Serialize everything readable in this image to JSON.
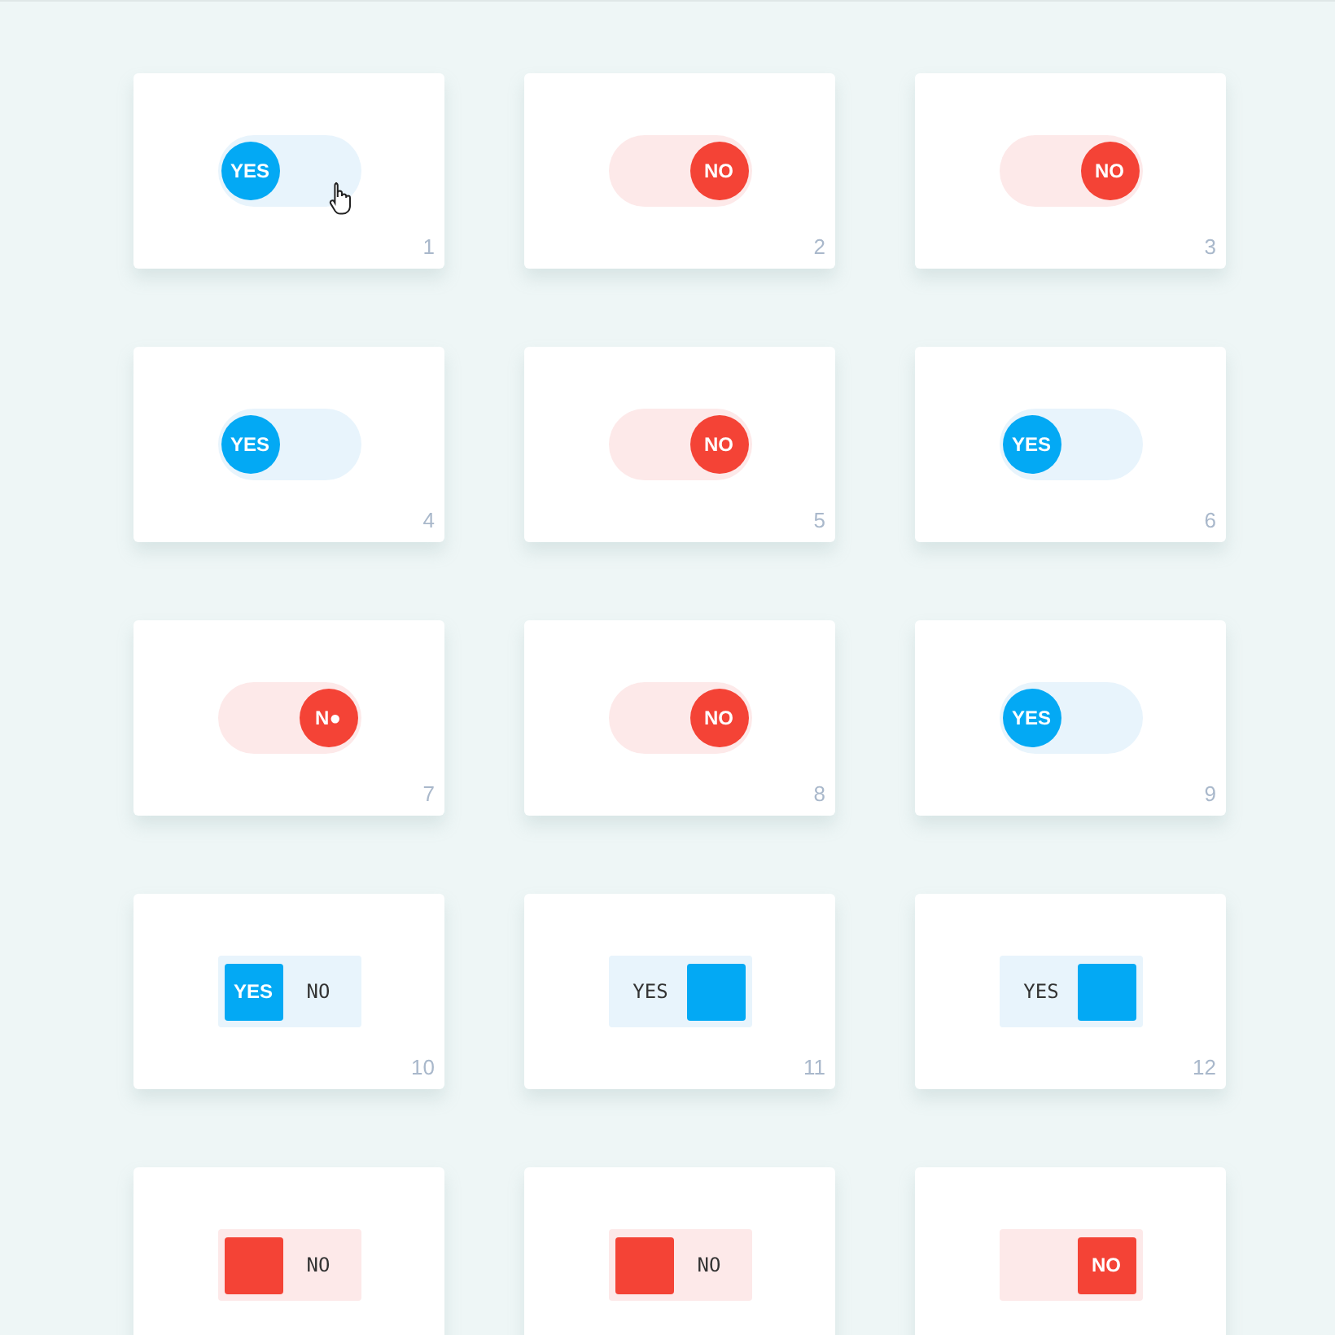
{
  "cards": [
    {
      "number": "1",
      "kind": "round",
      "on": true,
      "knob_right": false,
      "knob_label": "YES",
      "pointer": true
    },
    {
      "number": "2",
      "kind": "round",
      "on": false,
      "knob_right": true,
      "knob_label": "NO",
      "pointer": false
    },
    {
      "number": "3",
      "kind": "round",
      "on": false,
      "knob_right": true,
      "knob_label": "NO",
      "pointer": false
    },
    {
      "number": "4",
      "kind": "round",
      "on": true,
      "knob_right": false,
      "knob_label": "YES",
      "pointer": false
    },
    {
      "number": "5",
      "kind": "round",
      "on": false,
      "knob_right": true,
      "knob_label": "NO",
      "pointer": false
    },
    {
      "number": "6",
      "kind": "round",
      "on": true,
      "knob_right": false,
      "knob_label": "YES",
      "pointer": false
    },
    {
      "number": "7",
      "kind": "round",
      "on": false,
      "knob_right": true,
      "knob_label": "N●",
      "pointer": false
    },
    {
      "number": "8",
      "kind": "round",
      "on": false,
      "knob_right": true,
      "knob_label": "NO",
      "pointer": false
    },
    {
      "number": "9",
      "kind": "round",
      "on": true,
      "knob_right": false,
      "knob_label": "YES",
      "pointer": false
    },
    {
      "number": "10",
      "kind": "square",
      "on": true,
      "knob_right": false,
      "knob_label": "YES",
      "track_label": "NO",
      "pointer": false
    },
    {
      "number": "11",
      "kind": "square",
      "on": true,
      "knob_right": true,
      "track_label": "YES",
      "pointer": false
    },
    {
      "number": "12",
      "kind": "square",
      "on": true,
      "knob_right": true,
      "track_label": "YES",
      "pointer": false
    },
    {
      "kind": "square",
      "on": false,
      "knob_right": false,
      "track_label": "NO",
      "pointer": false
    },
    {
      "kind": "square",
      "on": false,
      "knob_right": false,
      "track_label": "NO",
      "pointer": false
    },
    {
      "kind": "square",
      "on": false,
      "knob_right": true,
      "knob_label": "NO",
      "pointer": false
    }
  ]
}
